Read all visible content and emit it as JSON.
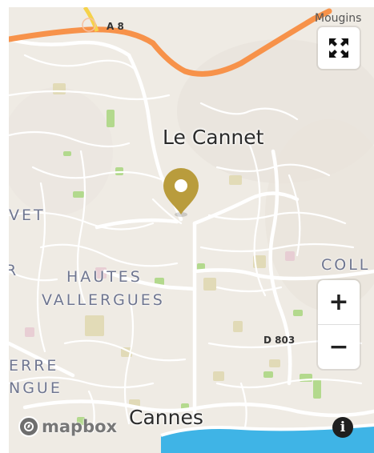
{
  "map": {
    "place_labels": {
      "le_cannet": "Le Cannet",
      "cannes": "Cannes",
      "mougins": "Mougins",
      "hautes_line1": "HAUTES",
      "hautes_line2": "VALLERGUES",
      "coll": "COLL",
      "vet_partial": "VET",
      "r_partial": "R",
      "erre_partial": "ERRE",
      "ngue_partial": "NGUE",
      "edge_letters": "V",
      "edge_letters2": "A"
    },
    "road_labels": {
      "a8": "A 8",
      "d803": "D 803"
    }
  },
  "controls": {
    "zoom_in": "+",
    "zoom_out": "−",
    "info": "i"
  },
  "attribution": {
    "brand": "mapbox"
  },
  "colors": {
    "land": "#efebe4",
    "road": "#ffffff",
    "motorway": "#f7924a",
    "water": "#3fb4e6",
    "park": "#a9d77f",
    "marker": "#b99c3c"
  },
  "icons": {
    "fullscreen": "fullscreen-icon",
    "marker": "map-pin-icon",
    "logo": "mapbox-logo-icon",
    "info": "info-icon"
  }
}
